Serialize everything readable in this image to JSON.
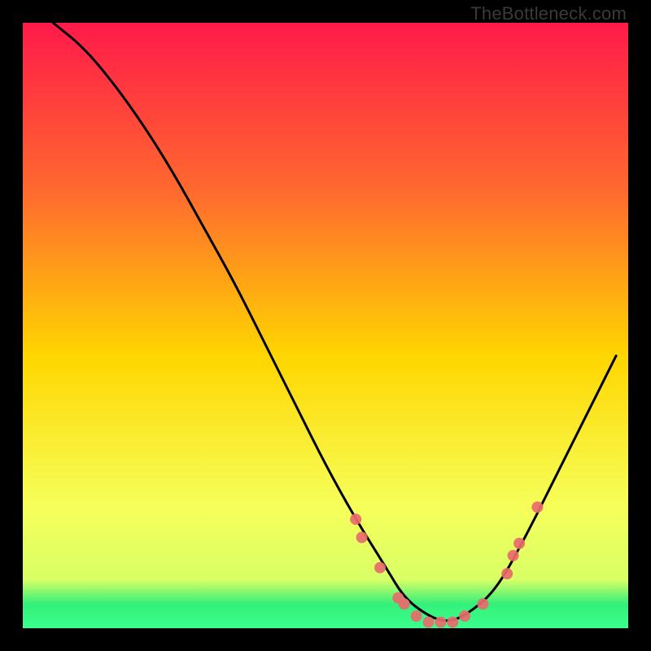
{
  "watermark": "TheBottleneck.com",
  "chart_data": {
    "type": "line",
    "title": "",
    "xlabel": "",
    "ylabel": "",
    "xlim": [
      0,
      100
    ],
    "ylim": [
      0,
      100
    ],
    "grid": false,
    "legend": false,
    "background_gradient": {
      "top": "#ff1a4a",
      "upper_mid": "#ff8a2a",
      "mid": "#ffd600",
      "lower_mid": "#f6ff5a",
      "green_band": "#34f07a",
      "bottom": "#3bff8e"
    },
    "curve": {
      "description": "V-shaped bottleneck curve",
      "x": [
        5,
        10,
        15,
        20,
        25,
        30,
        35,
        40,
        45,
        50,
        55,
        60,
        63,
        67,
        70,
        73,
        78,
        83,
        88,
        93,
        98
      ],
      "y": [
        100,
        96,
        90,
        83,
        75,
        66,
        57,
        47,
        37,
        27,
        18,
        10,
        5,
        2,
        1,
        2,
        6,
        15,
        25,
        35,
        45
      ]
    },
    "markers": {
      "color": "#e86b6b",
      "points": [
        {
          "x": 55,
          "y": 18
        },
        {
          "x": 56,
          "y": 15
        },
        {
          "x": 59,
          "y": 10
        },
        {
          "x": 62,
          "y": 5
        },
        {
          "x": 63,
          "y": 4
        },
        {
          "x": 65,
          "y": 2
        },
        {
          "x": 67,
          "y": 1
        },
        {
          "x": 69,
          "y": 1
        },
        {
          "x": 71,
          "y": 1
        },
        {
          "x": 73,
          "y": 2
        },
        {
          "x": 76,
          "y": 4
        },
        {
          "x": 80,
          "y": 9
        },
        {
          "x": 81,
          "y": 12
        },
        {
          "x": 82,
          "y": 14
        },
        {
          "x": 85,
          "y": 20
        }
      ]
    }
  }
}
